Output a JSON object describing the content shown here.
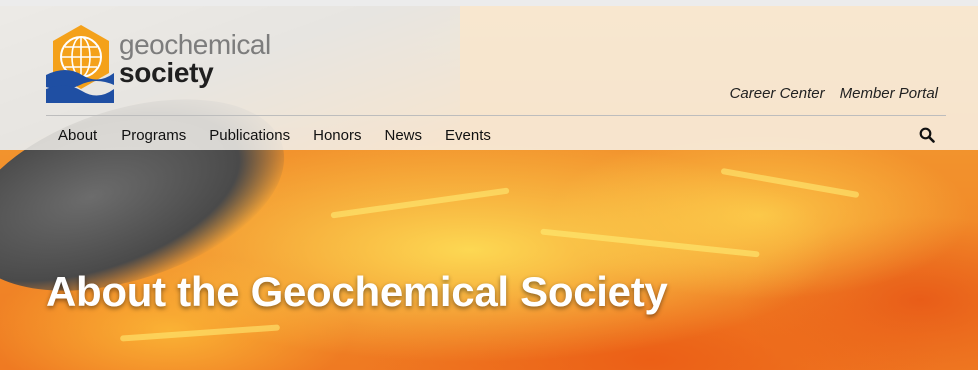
{
  "logo": {
    "name_line1": "geochemical",
    "name_line2": "society"
  },
  "utility_nav": {
    "items": [
      "Career Center",
      "Member Portal"
    ]
  },
  "main_nav": {
    "items": [
      "About",
      "Programs",
      "Publications",
      "Honors",
      "News",
      "Events"
    ]
  },
  "hero": {
    "title": "About the Geochemical Society"
  },
  "colors": {
    "logo_orange": "#f4a11a",
    "logo_blue": "#1f4fa3",
    "nav_text": "#111111",
    "title_text": "#ffffff"
  },
  "icons": {
    "search": "search-icon",
    "globe": "globe-icon"
  }
}
